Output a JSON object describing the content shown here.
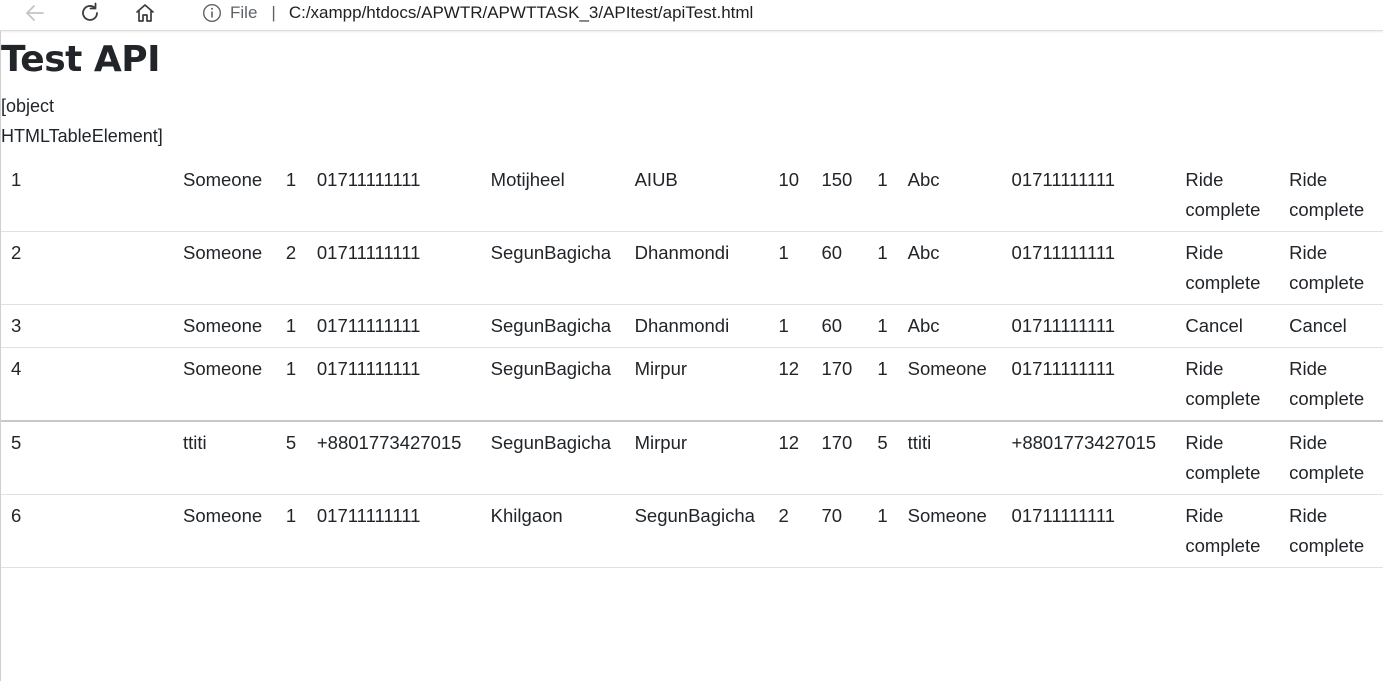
{
  "browser": {
    "address_scheme": "File",
    "address_url": "C:/xampp/htdocs/APWTR/APWTTASK_3/APItest/apiTest.html"
  },
  "page": {
    "title": "Test API",
    "object_text": "[object HTMLTableElement]"
  },
  "table": {
    "rows": [
      [
        "1",
        "Someone",
        "1",
        "01711111111",
        "Motijheel",
        "AIUB",
        "10",
        "150",
        "1",
        "Abc",
        "01711111111",
        "Ride complete",
        "Ride complete"
      ],
      [
        "2",
        "Someone",
        "2",
        "01711111111",
        "SegunBagicha",
        "Dhanmondi",
        "1",
        "60",
        "1",
        "Abc",
        "01711111111",
        "Ride complete",
        "Ride complete"
      ],
      [
        "3",
        "Someone",
        "1",
        "01711111111",
        "SegunBagicha",
        "Dhanmondi",
        "1",
        "60",
        "1",
        "Abc",
        "01711111111",
        "Cancel",
        "Cancel"
      ],
      [
        "4",
        "Someone",
        "1",
        "01711111111",
        "SegunBagicha",
        "Mirpur",
        "12",
        "170",
        "1",
        "Someone",
        "01711111111",
        "Ride complete",
        "Ride complete"
      ],
      [
        "5",
        "ttiti",
        "5",
        "+8801773427015",
        "SegunBagicha",
        "Mirpur",
        "12",
        "170",
        "5",
        "ttiti",
        "+8801773427015",
        "Ride complete",
        "Ride complete"
      ],
      [
        "6",
        "Someone",
        "1",
        "01711111111",
        "Khilgaon",
        "SegunBagicha",
        "2",
        "70",
        "1",
        "Someone",
        "01711111111",
        "Ride complete",
        "Ride complete"
      ]
    ]
  }
}
